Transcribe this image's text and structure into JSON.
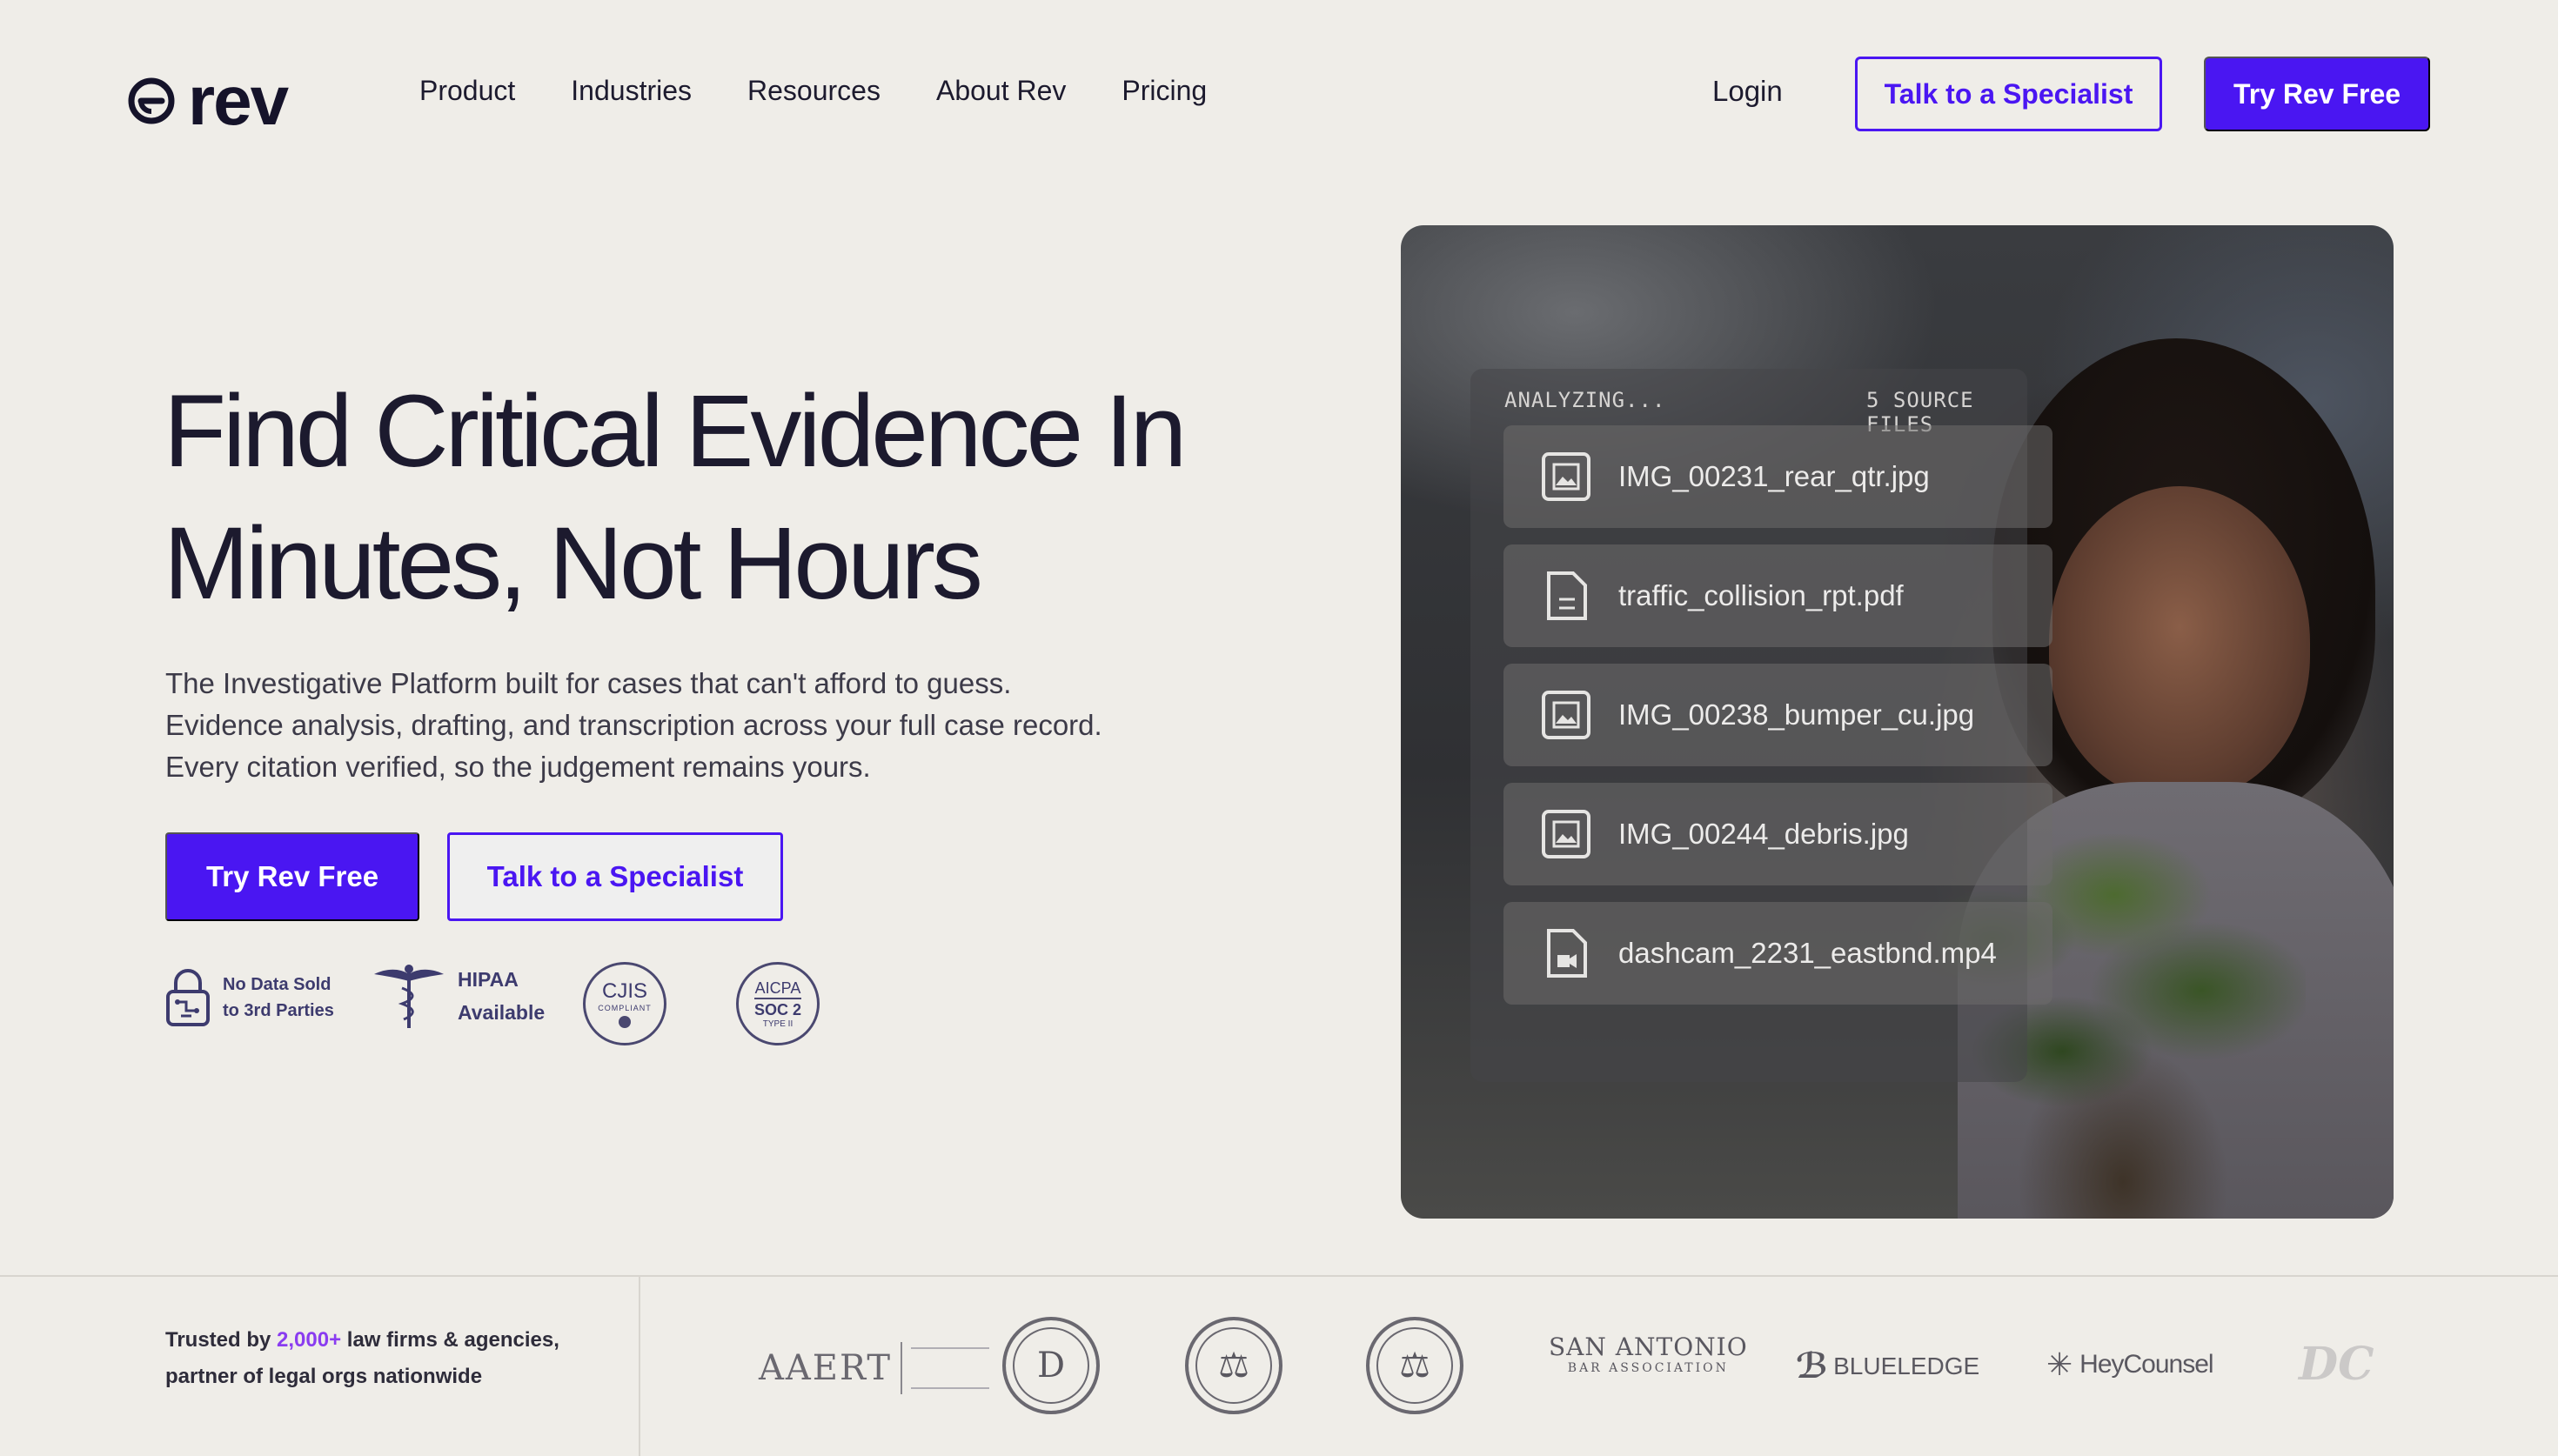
{
  "nav": {
    "logo_text": "rev",
    "links": [
      "Product",
      "Industries",
      "Resources",
      "About Rev",
      "Pricing"
    ],
    "login": "Login",
    "specialist_btn": "Talk to a Specialist",
    "try_btn": "Try Rev Free"
  },
  "hero": {
    "title_line1": "Find Critical Evidence In",
    "title_line2": "Minutes, Not Hours",
    "sub_line1": "The Investigative Platform built for cases that can't afford to guess.",
    "sub_line2": "Evidence analysis, drafting, and transcription across your full case record.",
    "sub_line3": "Every citation verified, so the judgement remains yours.",
    "primary_btn": "Try Rev Free",
    "secondary_btn": "Talk to a Specialist"
  },
  "badges": {
    "no_data_line1": "No Data Sold",
    "no_data_line2": "to 3rd Parties",
    "hipaa_line1": "HIPAA",
    "hipaa_line2": "Available",
    "cjis_title": "CJIS",
    "cjis_sub": "COMPLIANT",
    "soc_top": "AICPA",
    "soc_mid": "SOC 2",
    "soc_bottom": "TYPE II"
  },
  "media_panel": {
    "status": "ANALYZING...",
    "count": "5 SOURCE FILES",
    "files": [
      {
        "name": "IMG_00231_rear_qtr.jpg",
        "icon": "image-icon"
      },
      {
        "name": "traffic_collision_rpt.pdf",
        "icon": "document-icon"
      },
      {
        "name": "IMG_00238_bumper_cu.jpg",
        "icon": "image-icon"
      },
      {
        "name": "IMG_00244_debris.jpg",
        "icon": "image-icon"
      },
      {
        "name": "dashcam_2231_eastbnd.mp4",
        "icon": "video-file-icon"
      }
    ]
  },
  "trust": {
    "prefix": "Trusted by ",
    "count": "2,000+",
    "suffix": " law firms & agencies,",
    "line2": "partner of legal orgs nationwide",
    "partners": {
      "aaert": "AAERT",
      "dallas_seal": "D",
      "san_antonio_1": "SAN ANTONIO",
      "san_antonio_2": "BAR ASSOCIATION",
      "blueledge": "BLUELEDGE",
      "heycounsel": "HeyCounsel"
    }
  },
  "colors": {
    "accent": "#4a16f2",
    "background": "#efede8",
    "trust_accent": "#8a3cf0"
  }
}
